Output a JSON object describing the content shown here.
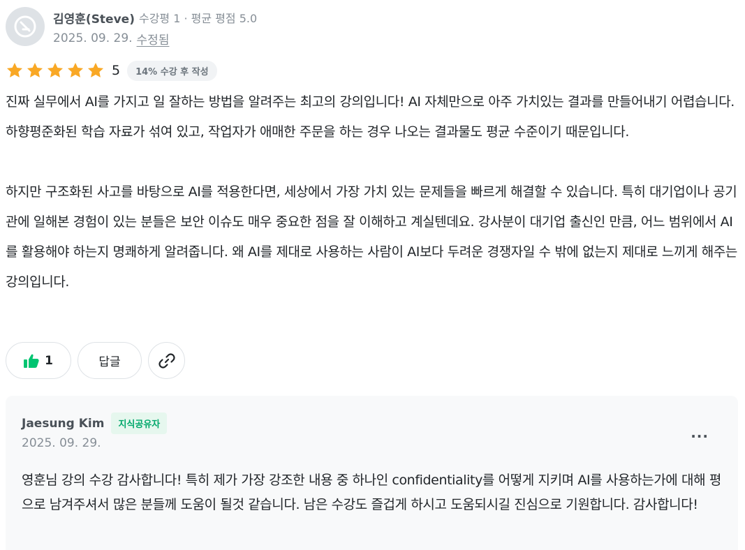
{
  "review": {
    "author": "김영훈(Steve)",
    "stats": "수강평 1 · 평균 평점 5.0",
    "date": "2025. 09. 29.",
    "edited_label": "수정됨",
    "rating": "5",
    "star_count": 5,
    "star_color": "#f9a825",
    "progress_badge": "14% 수강 후 작성",
    "paragraph1": "진짜 실무에서 AI를 가지고 일 잘하는 방법을 알려주는 최고의 강의입니다! AI 자체만으로 아주 가치있는 결과를 만들어내기 어렵습니다. 하향평준화된 학습 자료가 섞여 있고, 작업자가 애매한 주문을 하는 경우 나오는 결과물도 평균 수준이기 때문입니다.",
    "paragraph2": "하지만 구조화된 사고를 바탕으로 AI를 적용한다면, 세상에서 가장 가치 있는 문제들을 빠르게 해결할 수 있습니다. 특히 대기업이나 공기관에 일해본 경험이 있는 분들은 보안 이슈도 매우 중요한 점을 잘 이해하고 계실텐데요. 강사분이 대기업 출신인 만큼, 어느 범위에서 AI를 활용해야 하는지 명쾌하게 알려줍니다. 왜 AI를 제대로 사용하는 사람이 AI보다 두려운 경쟁자일 수 밖에 없는지 제대로 느끼게 해주는 강의입니다."
  },
  "actions": {
    "like_count": "1",
    "reply_label": "답글",
    "like_icon_color": "#00c471"
  },
  "reply": {
    "author": "Jaesung Kim",
    "badge": "지식공유자",
    "date": "2025. 09. 29.",
    "more_label": "···",
    "content": "영훈님 강의 수강 감사합니다! 특히 제가 가장 강조한 내용 중 하나인 confidentiality를 어떻게 지키며 AI를 사용하는가에 대해 평으로 남겨주셔서 많은 분들께 도움이 될것 같습니다. 남은 수강도 즐겁게 하시고 도움되시길 진심으로 기원합니다. 감사합니다!"
  }
}
